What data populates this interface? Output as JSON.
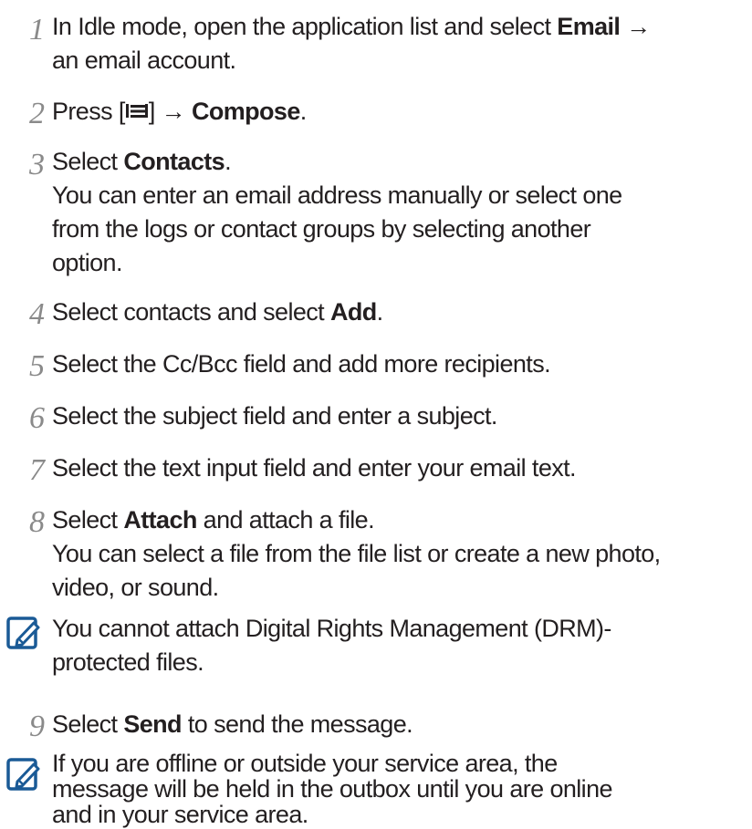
{
  "steps": [
    {
      "number": "1",
      "lines": [
        [
          "In Idle mode, open the application list and select ",
          {
            "b": "Email"
          },
          " →"
        ],
        [
          "an email account."
        ]
      ]
    },
    {
      "number": "2",
      "lines": [
        [
          "Press [",
          {
            "icon": "menu-key-icon"
          },
          "] → ",
          {
            "b": "Compose"
          },
          "."
        ]
      ]
    },
    {
      "number": "3",
      "lines": [
        [
          "Select ",
          {
            "b": "Contacts"
          },
          "."
        ],
        [
          "You can enter an email address manually or select one"
        ],
        [
          "from the logs or contact groups by selecting another"
        ],
        [
          "option."
        ]
      ]
    },
    {
      "number": "4",
      "lines": [
        [
          "Select contacts and select ",
          {
            "b": "Add"
          },
          "."
        ]
      ]
    },
    {
      "number": "5",
      "lines": [
        [
          "Select the Cc/Bcc field and add more recipients."
        ]
      ]
    },
    {
      "number": "6",
      "lines": [
        [
          "Select the subject field and enter a subject."
        ]
      ]
    },
    {
      "number": "7",
      "lines": [
        [
          "Select the text input field and enter your email text."
        ]
      ]
    },
    {
      "number": "8",
      "lines": [
        [
          "Select ",
          {
            "b": "Attach"
          },
          " and attach a file."
        ],
        [
          "You can select a file from the file list or create a new photo,"
        ],
        [
          "video, or sound."
        ]
      ]
    },
    {
      "number": "9",
      "lines": [
        [
          "Select ",
          {
            "b": "Send"
          },
          " to send the message."
        ]
      ]
    }
  ],
  "notes": [
    {
      "icon": "note-pencil-icon",
      "lines": [
        [
          "You cannot attach Digital Rights Management (DRM)-"
        ],
        [
          "protected files."
        ]
      ]
    },
    {
      "icon": "note-pencil-icon",
      "lines": [
        [
          "If you are offline or outside your service area, the"
        ],
        [
          "message will be held in the outbox until you are online"
        ],
        [
          "and in your service area."
        ]
      ]
    }
  ],
  "colors": {
    "text": "#231f20",
    "step_number": "#8a8a8a",
    "note_icon": "#1a5a96"
  }
}
